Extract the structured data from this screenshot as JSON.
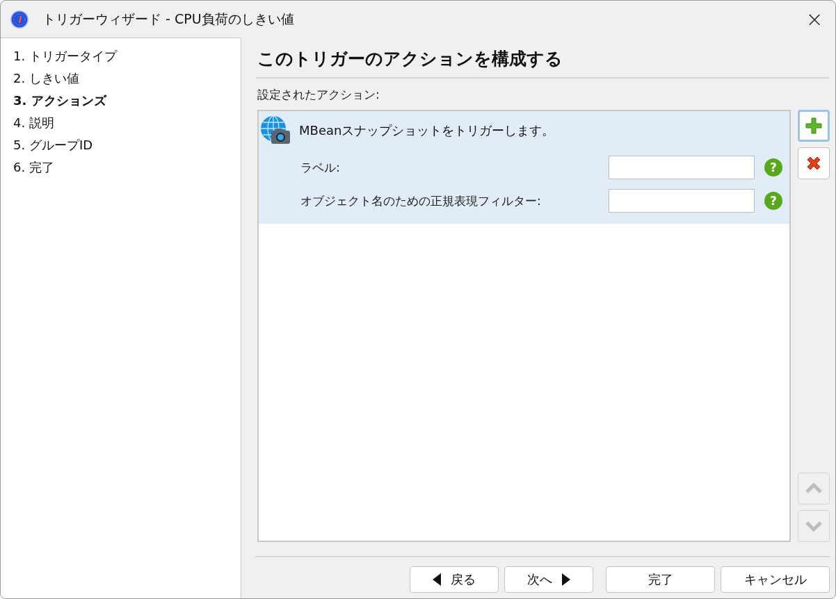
{
  "window": {
    "title": "トリガーウィザード - CPU負荷のしきい値",
    "close": "×"
  },
  "steps": [
    {
      "label": "1. トリガータイプ",
      "selected": false
    },
    {
      "label": "2. しきい値",
      "selected": false
    },
    {
      "label": "3. アクションズ",
      "selected": true
    },
    {
      "label": "4. 説明",
      "selected": false
    },
    {
      "label": "5. グループID",
      "selected": false
    },
    {
      "label": "6. 完了",
      "selected": false
    }
  ],
  "heading": "このトリガーのアクションを構成する",
  "actions_label": "設定されたアクション:",
  "actions": [
    {
      "title": "MBeanスナップショットをトリガーします。",
      "selected": true,
      "fields": [
        {
          "label": "ラベル:",
          "help": "?"
        },
        {
          "label": "オブジェクト名のための正規表現フィルター:",
          "help": "?"
        }
      ]
    }
  ],
  "side_buttons": [
    {
      "kind": "add",
      "disabled": false,
      "focused": true
    },
    {
      "kind": "remove",
      "disabled": false,
      "focused": false
    },
    {
      "kind": "up",
      "disabled": true,
      "focused": false
    },
    {
      "kind": "down",
      "disabled": true,
      "focused": false
    }
  ],
  "buttons": [
    {
      "label": "戻る",
      "kind": "back"
    },
    {
      "label": "次へ",
      "kind": "next"
    },
    {
      "label": "完了",
      "kind": "finish"
    },
    {
      "label": "キャンセル",
      "kind": "cancel"
    }
  ]
}
